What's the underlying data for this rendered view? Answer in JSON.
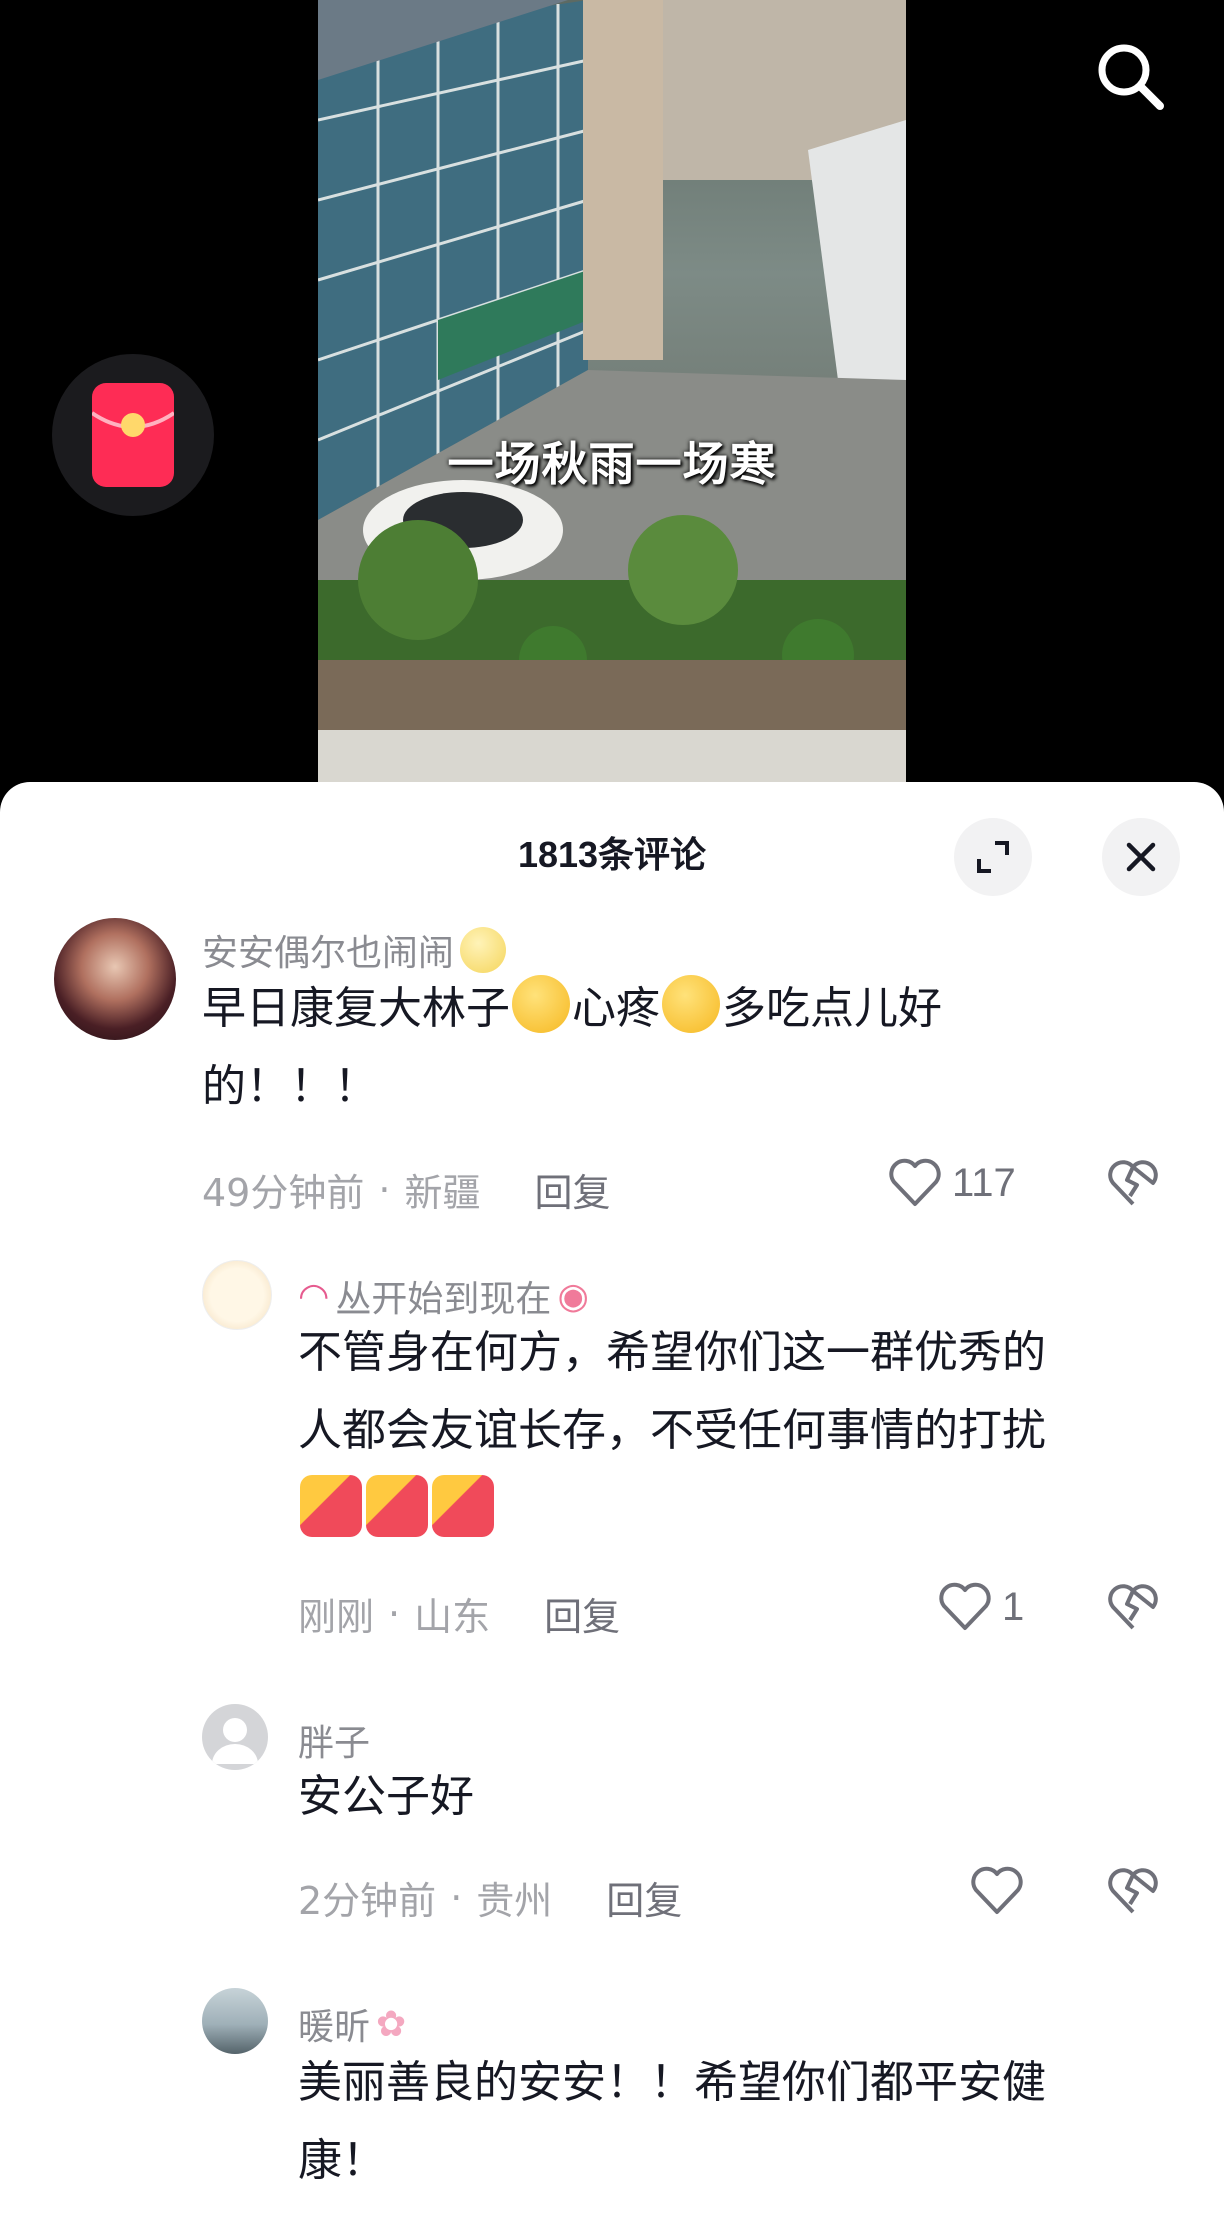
{
  "video": {
    "caption": "一场秋雨一场寒"
  },
  "header_icons": {
    "search": "search-icon",
    "red_packet": "red-packet-icon"
  },
  "comments_panel": {
    "title": "1813条评论",
    "expand_icon": "expand-icon",
    "close_icon": "close-icon"
  },
  "comments": [
    {
      "username": "安安偶尔也闹闹",
      "text_line1_a": "早日康复大林子",
      "text_line1_b": "心疼",
      "text_line1_c": "多吃点儿好",
      "text_line2": "的！！！",
      "time": "49分钟前",
      "location": "新疆",
      "reply": "回复",
      "likes": "117"
    },
    {
      "username": "丛开始到现在",
      "text_line1": "不管身在何方，希望你们这一群优秀的",
      "text_line2": "人都会友谊长存，不受任何事情的打扰",
      "time": "刚刚",
      "location": "山东",
      "reply": "回复",
      "likes": "1"
    },
    {
      "username": "胖子",
      "text_line1": "安公子好",
      "time": "2分钟前",
      "location": "贵州",
      "reply": "回复",
      "likes": ""
    },
    {
      "username": "暖昕",
      "text_line1": "美丽善良的安安！！希望你们都平安健",
      "text_line2": "康！"
    }
  ],
  "colors": {
    "panel_bg": "#ffffff",
    "text_primary": "#161823",
    "text_secondary": "#8a8b91",
    "red_packet": "#fe2c55"
  }
}
